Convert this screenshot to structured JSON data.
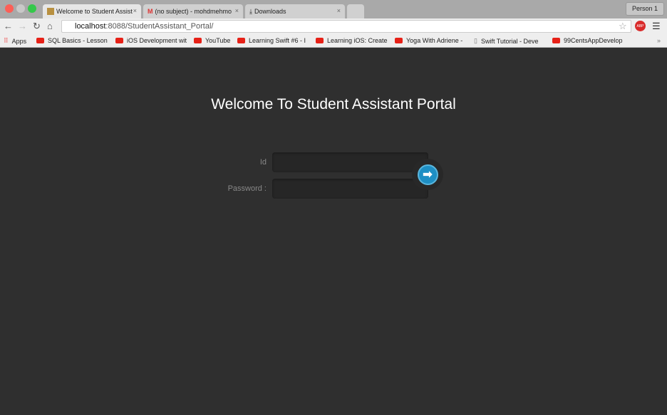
{
  "browser": {
    "tabs": [
      {
        "label": "Welcome to Student Assist",
        "active": true
      },
      {
        "label": "(no subject) - mohdmehmo",
        "active": false
      },
      {
        "label": "Downloads",
        "active": false
      }
    ],
    "close_glyph": "×",
    "profile": "Person 1",
    "url_host": "localhost",
    "url_rest": ":8088/StudentAssistant_Portal/",
    "bookmarks": [
      "Apps",
      "SQL Basics - Lesson",
      "iOS Development wit",
      "YouTube",
      "Learning Swift #6 - I",
      "Learning iOS: Create",
      "Yoga With Adriene -",
      "Swift Tutorial - Deve",
      "99CentsAppDevelop"
    ],
    "more": "»",
    "abp": "ABP"
  },
  "page": {
    "title": "Welcome To Student Assistant Portal",
    "id_label": "Id",
    "password_label": "Password :",
    "submit_glyph": "➡"
  },
  "colors": {
    "accent": "#1e8fc4",
    "background": "#2f2f2f"
  }
}
